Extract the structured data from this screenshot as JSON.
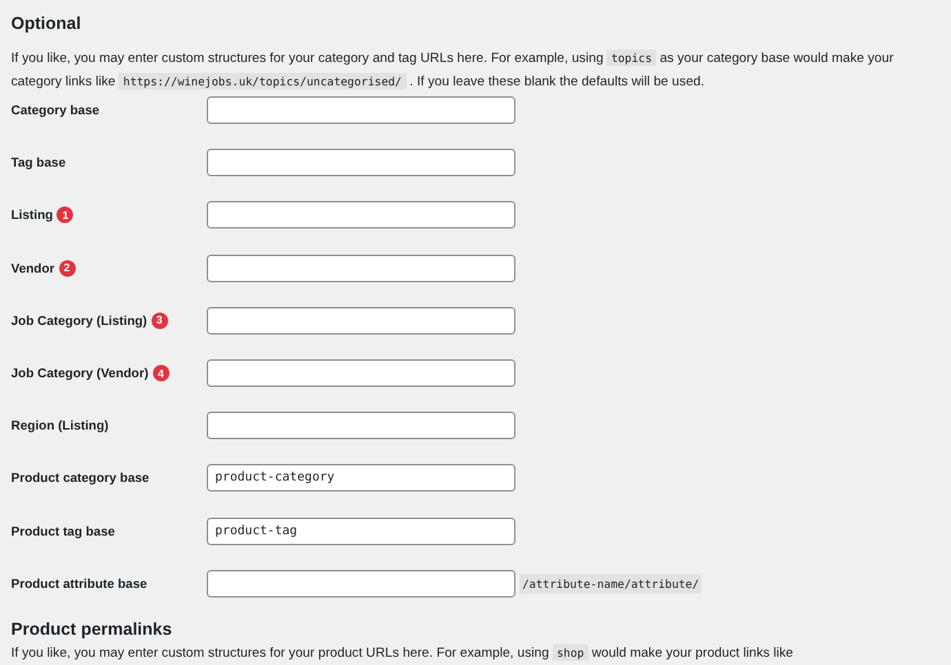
{
  "sections": [
    {
      "title": "Optional",
      "description": [
        {
          "kind": "text",
          "text": "If you like, you may enter custom structures for your category and tag URLs here. For example, using "
        },
        {
          "kind": "code",
          "text": "topics"
        },
        {
          "kind": "text",
          "text": " as your category base would make your category links like "
        },
        {
          "kind": "code",
          "text": "https://winejobs.uk/topics/uncategorised/"
        },
        {
          "kind": "text",
          "text": " . If you leave these blank the defaults will be used."
        }
      ],
      "fields": [
        {
          "label": "Category base"
        },
        {
          "label": "Tag base"
        },
        {
          "label": "Listing",
          "badge": "1"
        },
        {
          "label": "Vendor",
          "badge": "2"
        },
        {
          "label": "Job Category (Listing)",
          "badge": "3"
        },
        {
          "label": "Job Category (Vendor)",
          "badge": "4"
        },
        {
          "label": "Region (Listing)"
        },
        {
          "label": "Product category base",
          "value": "product-category"
        },
        {
          "label": "Product tag base",
          "value": "product-tag"
        },
        {
          "label": "Product attribute base",
          "suffix": "/attribute-name/attribute/"
        }
      ]
    },
    {
      "title": "Product permalinks",
      "description": [
        {
          "kind": "text",
          "text": "If you like, you may enter custom structures for your product URLs here. For example, using "
        },
        {
          "kind": "code",
          "text": "shop"
        },
        {
          "kind": "text",
          "text": " would make your product links like"
        }
      ]
    }
  ]
}
